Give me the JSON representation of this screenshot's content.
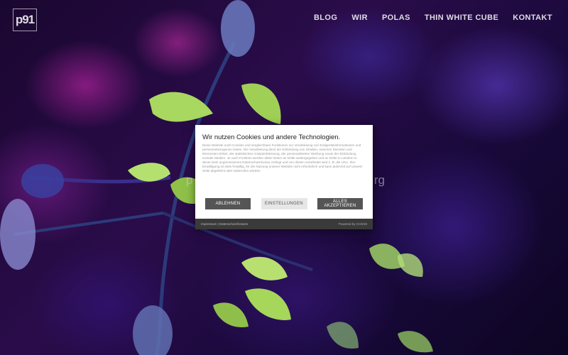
{
  "logo": {
    "text": "p91"
  },
  "nav": {
    "items": [
      {
        "label": "BLOG"
      },
      {
        "label": "WIR"
      },
      {
        "label": "POLAS"
      },
      {
        "label": "THIN WHITE CUBE"
      },
      {
        "label": "KONTAKT"
      }
    ]
  },
  "hero": {
    "left": "p",
    "right": "rg"
  },
  "cookie": {
    "title": "Wir nutzen Cookies und andere Technologien.",
    "body": "Diese Website nutzt Cookies und vergleichbare Funktionen zur Verarbeitung von Endgeräteinformationen und personenbezogenen Daten. Die Verarbeitung dient der Einbindung von Inhalten, externen Diensten und Elementen Dritter, der statistischen Analyse/Messung, der personalisierten Werbung sowie der Einbindung sozialer Medien. Je nach Funktion werden dabei Daten an Dritte weitergegeben und an Dritte in Ländern in denen kein angemessenes Datenschutzniveau vorliegt und von diesen verarbeitet wird z. B. die USA. Ihre Einwilligung ist stets freiwillig, für die Nutzung unserer Website nicht erforderlich und kann jederzeit auf unserer Seite abgelehnt oder widerrufen werden.",
    "reject_label": "ABLEHNEN",
    "settings_label": "EINSTELLUNGEN",
    "accept_label": "ALLES AKZEPTIEREN",
    "footer_links": "Impressum | Datenschutzhinweis",
    "powered": "Powered by CCM19"
  },
  "colors": {
    "dialog_button_dark": "#555555",
    "dialog_button_light": "#e6e6e6",
    "dialog_footer": "#3a3a3a"
  }
}
